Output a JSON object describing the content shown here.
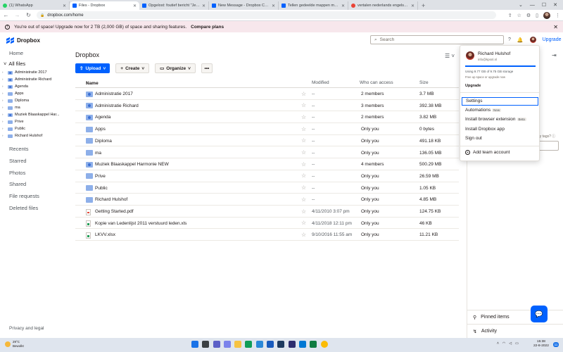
{
  "browser": {
    "tabs": [
      {
        "label": "(1) WhatsApp",
        "icon": "whatsapp-icon"
      },
      {
        "label": "Files - Dropbox",
        "icon": "dropbox-icon",
        "active": true
      },
      {
        "label": "Opgelost: foutief bericht \"Je Dro",
        "icon": "dropbox-icon"
      },
      {
        "label": "New Message - Dropbox Commu",
        "icon": "dropbox-icon"
      },
      {
        "label": "Tellen gedeelde mappen mee vo",
        "icon": "dropbox-icon"
      },
      {
        "label": "vertalen nederlands engels - Goo",
        "icon": "google-icon"
      }
    ],
    "new_tab": "+",
    "url": "dropbox.com/home"
  },
  "banner": {
    "text": "You're out of space! Upgrade now for 2 TB (2,000 GB) of space and sharing features.",
    "cta": "Compare plans"
  },
  "header": {
    "logo": "Dropbox",
    "search_placeholder": "Search",
    "upgrade": "Upgrade"
  },
  "nav": {
    "home": "Home",
    "all_files": "All files",
    "tree": [
      {
        "label": "Administratie 2017",
        "shared": true
      },
      {
        "label": "Administratie Richard",
        "shared": true
      },
      {
        "label": "Agenda",
        "shared": true
      },
      {
        "label": "Apps",
        "shared": false
      },
      {
        "label": "Diploma",
        "shared": false
      },
      {
        "label": "ma",
        "shared": false
      },
      {
        "label": "Muziek Blaaskappel Har...",
        "shared": true
      },
      {
        "label": "Prive",
        "shared": false
      },
      {
        "label": "Public",
        "shared": false
      },
      {
        "label": "Richard Hulshof",
        "shared": false
      }
    ],
    "sections": [
      "Recents",
      "Starred",
      "Photos",
      "Shared",
      "File requests",
      "Deleted files"
    ],
    "privacy": "Privacy and legal"
  },
  "main": {
    "breadcrumb": "Dropbox",
    "upload": "Upload",
    "create": "Create",
    "organize": "Organize",
    "more": "•••",
    "columns": {
      "name": "Name",
      "name_sort": "↑",
      "modified": "Modified",
      "access": "Who can access",
      "size": "Size"
    },
    "rows": [
      {
        "name": "Administratie 2017",
        "type": "folder-shared",
        "modified": "--",
        "access": "2 members",
        "size": "3.7 MB"
      },
      {
        "name": "Administratie Richard",
        "type": "folder-shared",
        "modified": "--",
        "access": "3 members",
        "size": "392.38 MB"
      },
      {
        "name": "Agenda",
        "type": "folder-shared",
        "modified": "--",
        "access": "2 members",
        "size": "3.82 MB"
      },
      {
        "name": "Apps",
        "type": "folder",
        "modified": "--",
        "access": "Only you",
        "size": "0 bytes"
      },
      {
        "name": "Diploma",
        "type": "folder",
        "modified": "--",
        "access": "Only you",
        "size": "491.18 KB"
      },
      {
        "name": "ma",
        "type": "folder",
        "modified": "--",
        "access": "Only you",
        "size": "136.05 MB"
      },
      {
        "name": "Muziek Blaaskappel Harmonie NEW",
        "type": "folder-shared",
        "modified": "--",
        "access": "4 members",
        "size": "500.29 MB"
      },
      {
        "name": "Prive",
        "type": "folder",
        "modified": "--",
        "access": "Only you",
        "size": "26.59 MB"
      },
      {
        "name": "Public",
        "type": "folder",
        "modified": "--",
        "access": "Only you",
        "size": "1.05 KB"
      },
      {
        "name": "Richard Hulshof",
        "type": "folder",
        "modified": "--",
        "access": "Only you",
        "size": "4.85 MB"
      },
      {
        "name": "Getting Started.pdf",
        "type": "pdf",
        "modified": "4/11/2010 3:07 pm",
        "access": "Only you",
        "size": "124.75 KB"
      },
      {
        "name": "Kopie van Ledenlijst 2011 verstuurd leden.xls",
        "type": "xls",
        "modified": "4/11/2018 12:11 pm",
        "access": "Only you",
        "size": "46 KB"
      },
      {
        "name": "LKVV.xlsx",
        "type": "xls",
        "modified": "9/10/2016 11:55 am",
        "access": "Only you",
        "size": "11.21 KB"
      }
    ]
  },
  "account_menu": {
    "name": "Richard Hulshof",
    "email": "info@kpsnl.nl",
    "usage": "Using 9.77 GB of 9.75 GB storage",
    "free_up": "Free up space or upgrade now",
    "storage_used_fraction": 1.0,
    "upgrade": "Upgrade",
    "items": [
      {
        "label": "Settings",
        "pill": "",
        "focused": true
      },
      {
        "label": "Automations",
        "pill": "New",
        "focused": false
      },
      {
        "label": "Install browser extension",
        "pill": "Beta",
        "focused": false
      },
      {
        "label": "Install Dropbox app",
        "pill": "",
        "focused": false
      },
      {
        "label": "Sign out",
        "pill": "",
        "focused": false
      }
    ],
    "add_team": "Add team account"
  },
  "right_panel": {
    "tags_hint": "ny tags?",
    "pinned": "Pinned items",
    "activity": "Activity"
  },
  "taskbar": {
    "temp": "29°C",
    "weather": "Bewolkt",
    "time": "15:38",
    "date": "22-8-2022",
    "notifications": "11"
  },
  "colors": {
    "accent": "#0061fe",
    "banner_bg": "#f7e7ec",
    "folder": "#8dafe9"
  }
}
